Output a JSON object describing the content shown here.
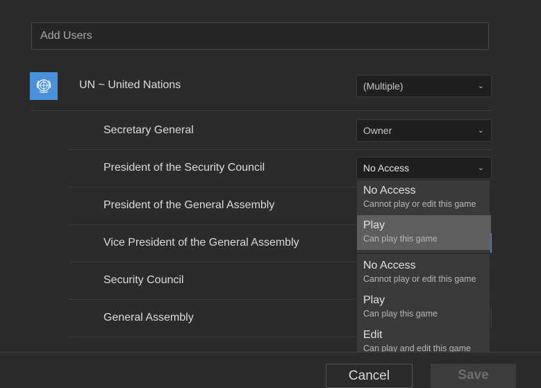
{
  "search": {
    "placeholder": "Add Users"
  },
  "org": {
    "name": "UN ~ United Nations",
    "access": "(Multiple)",
    "logo_color": "#4a8fd9"
  },
  "roles": [
    {
      "label": "Secretary General",
      "access": "Owner"
    },
    {
      "label": "President of the Security Council",
      "access": "No Access"
    },
    {
      "label": "President of the General Assembly",
      "access": ""
    },
    {
      "label": "Vice President of the General Assembly",
      "access": ""
    },
    {
      "label": "Security Council",
      "access": ""
    },
    {
      "label": "General Assembly",
      "access": ""
    }
  ],
  "dropdown": {
    "options": [
      {
        "title": "No Access",
        "subtitle": "Cannot play or edit this game"
      },
      {
        "title": "Play",
        "subtitle": "Can play this game",
        "highlighted": true
      },
      {
        "title": "No Access",
        "subtitle": "Cannot play or edit this game"
      },
      {
        "title": "Play",
        "subtitle": "Can play this game"
      },
      {
        "title": "Edit",
        "subtitle": "Can play and edit this game"
      }
    ]
  },
  "footer": {
    "cancel_label": "Cancel",
    "save_label": "Save"
  },
  "icons": {
    "chevron": "chevron-down-icon",
    "logo": "un-emblem-icon"
  }
}
